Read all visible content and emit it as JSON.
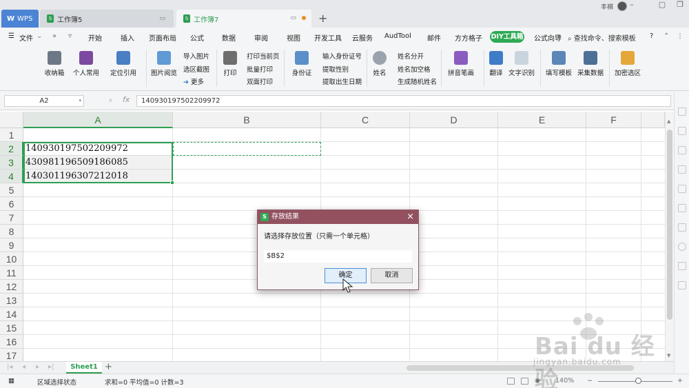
{
  "titlebar": {
    "tabs": [
      {
        "label": "WPS"
      },
      {
        "label": "工作簿5"
      },
      {
        "label": "工作簿7"
      }
    ],
    "new_tab": "+",
    "user_name": "丰祺"
  },
  "menu": {
    "file": "文件",
    "items": [
      "开始",
      "插入",
      "页面布局",
      "公式",
      "数据",
      "审阅",
      "视图",
      "开发工具",
      "云服务",
      "AudTool",
      "邮件",
      "方方格子",
      "公式向导"
    ],
    "diy": "DIY工具箱",
    "search": "查找命令、搜索模板",
    "help": "?"
  },
  "ribbon": {
    "buttons": {
      "shoucangxiang": "收纳箱",
      "geren": "个人常用",
      "dingwei": "定位引用",
      "tupian": "图片阅览",
      "dayin": "打印",
      "shenfenzheng": "身份证",
      "xingming": "姓名",
      "pinyin": "拼音笔画",
      "fanyi": "翻译",
      "wenzi": "文字识别",
      "tianxie": "填写模板",
      "caiji": "采集数据",
      "jiami": "加密选区"
    },
    "small": {
      "daoru": "导入图片",
      "xuanqu": "选区截图",
      "gengduo": "更多",
      "dangqianye": "打印当前页",
      "piliang": "批量打印",
      "shuangmian": "双面打印",
      "shuru": "输入身份证号",
      "xingbie": "提取性别",
      "shengri": "提取出生日期",
      "fenkai": "姓名分开",
      "kongge": "姓名加空格",
      "suiji": "生成随机姓名"
    }
  },
  "formula": {
    "namebox": "A2",
    "content": "140930197502209972"
  },
  "grid": {
    "columns": [
      "A",
      "B",
      "C",
      "D",
      "E",
      "F"
    ],
    "rows": [
      "1",
      "2",
      "3",
      "4",
      "5",
      "6",
      "7",
      "8",
      "9",
      "10",
      "11",
      "12",
      "13",
      "14",
      "15",
      "16",
      "17"
    ],
    "cells": {
      "A2": "140930197502209972",
      "A3": "430981196509186085",
      "A4": "140301196307212018"
    }
  },
  "sheets": {
    "active": "Sheet1",
    "add": "+"
  },
  "status": {
    "mode": "区域选择状态",
    "stats": "求和=0  平均值=0  计数=3",
    "zoom": "140%"
  },
  "dialog": {
    "title": "存放结果",
    "prompt": "请选择存放位置（只需一个单元格）",
    "value": "$B$2",
    "ok": "确定",
    "cancel": "取消",
    "close": "×"
  },
  "watermark": {
    "brand": "Bai du 经验",
    "url": "jingyan.baidu.com"
  },
  "colors": {
    "accent_green": "#2e9e53",
    "dialog_title": "#93515f",
    "wps_blue": "#4b84d4"
  }
}
